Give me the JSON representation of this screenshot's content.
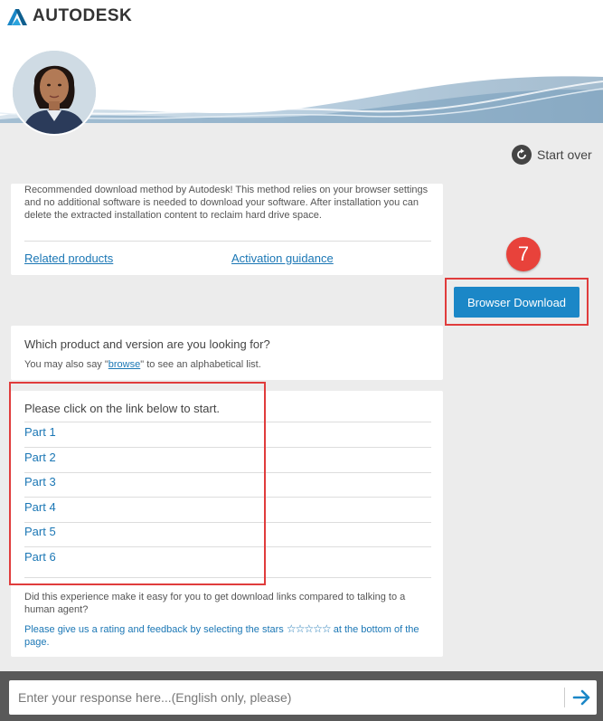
{
  "brand": {
    "name": "AUTODESK"
  },
  "header": {
    "start_over": "Start over"
  },
  "download_card": {
    "description": "Recommended download method by Autodesk! This method relies on your browser settings and no additional software is needed to download your software. After installation you can delete the extracted installation content to reclaim hard drive space.",
    "related_products": "Related products",
    "activation_guidance": "Activation guidance"
  },
  "step_badge": "7",
  "browser_download_label": "Browser Download",
  "question_card": {
    "question": "Which product and version are you looking for?",
    "hint_prefix": "You may also say \"",
    "hint_link": "browse",
    "hint_suffix": "\" to see an alphabetical list."
  },
  "parts_card": {
    "intro": "Please click on the link below to start.",
    "parts": [
      "Part 1",
      "Part 2",
      "Part 3",
      "Part 4",
      "Part 5",
      "Part 6"
    ],
    "feedback_question": "Did this experience make it easy for you to get download links compared to talking to a human agent?",
    "feedback_prompt_prefix": "Please give us a rating and feedback by selecting the stars",
    "stars": "☆☆☆☆☆",
    "feedback_prompt_suffix": "at the bottom of the page."
  },
  "input": {
    "placeholder": "Enter your response here...(English only, please)"
  },
  "colors": {
    "accent": "#1b87c7",
    "link": "#1b77b5",
    "highlight": "#e03c3c",
    "badge": "#e8423b"
  }
}
